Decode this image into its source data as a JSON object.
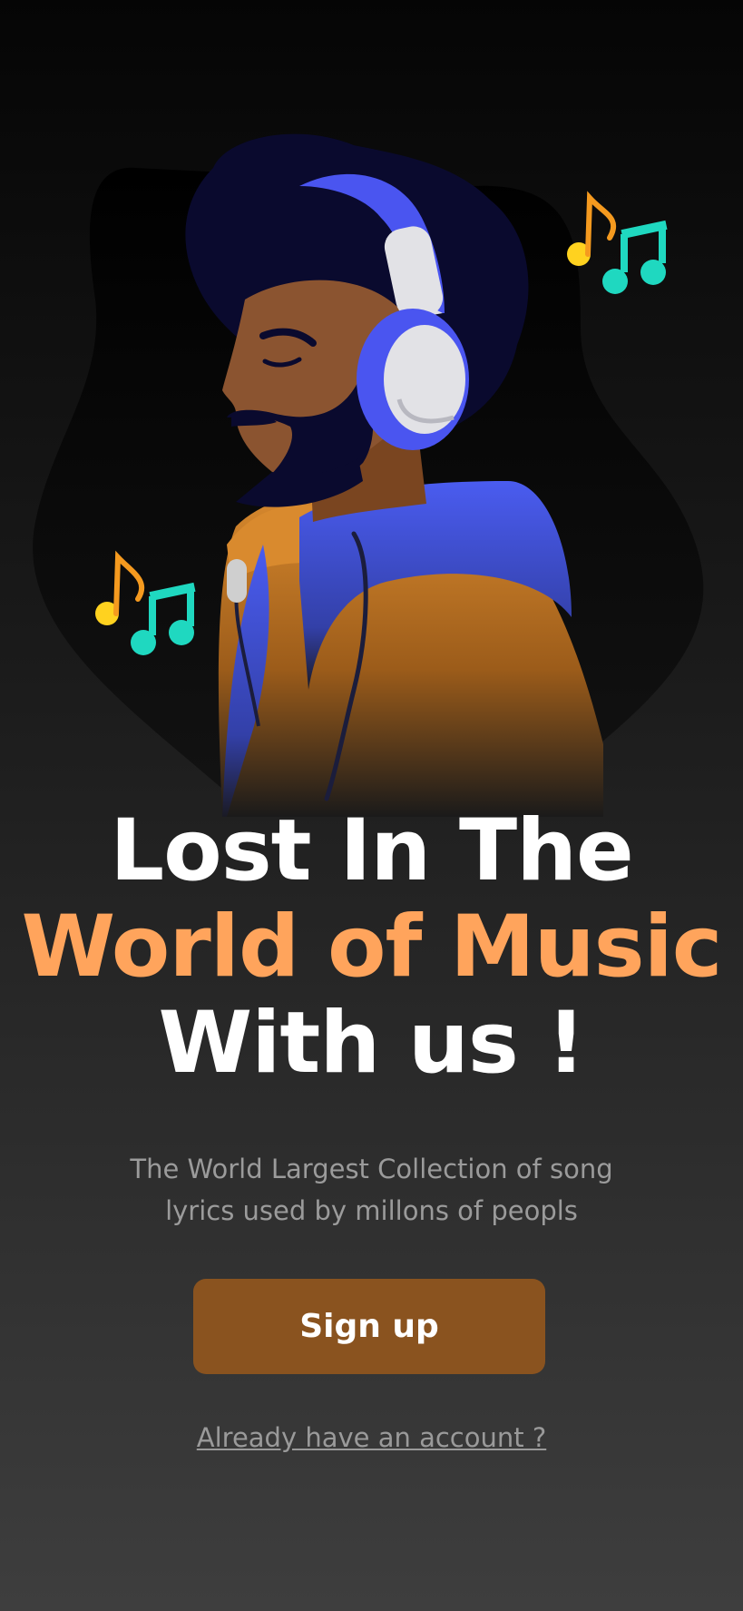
{
  "hero": {
    "illustration_icon": "person-with-headphones-illustration",
    "note_icon": "music-notes-icon"
  },
  "headline": {
    "line1": "Lost In The",
    "line2": "World of Music",
    "line3": "With us !"
  },
  "subtitle": {
    "line1": "The World Largest Collection of song",
    "line2": "lyrics used by millons of peopls"
  },
  "actions": {
    "signup_label": "Sign up",
    "login_link": "Already have an account ?"
  },
  "colors": {
    "accent_orange": "#ffa45c",
    "button_brown": "#8a531f",
    "headphone_blue": "#4a55f0",
    "note_teal": "#1fd8c0",
    "note_yellow": "#ffd21f"
  }
}
